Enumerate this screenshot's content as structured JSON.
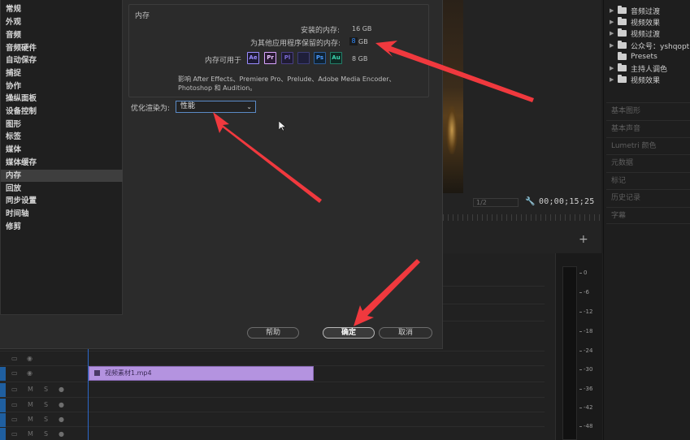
{
  "colors": {
    "accent_red": "#f0393e",
    "clip_purple": "#b493e0",
    "track_blue": "#1f5fa0",
    "playhead": "#2c67c9"
  },
  "sidebar": {
    "items": [
      {
        "label": "常规"
      },
      {
        "label": "外观"
      },
      {
        "label": "音频"
      },
      {
        "label": "音频硬件"
      },
      {
        "label": "自动保存"
      },
      {
        "label": "捕捉"
      },
      {
        "label": "协作"
      },
      {
        "label": "操纵面板"
      },
      {
        "label": "设备控制"
      },
      {
        "label": "图形"
      },
      {
        "label": "标签"
      },
      {
        "label": "媒体"
      },
      {
        "label": "媒体缓存"
      },
      {
        "label": "内存"
      },
      {
        "label": "回放"
      },
      {
        "label": "同步设置"
      },
      {
        "label": "时间轴"
      },
      {
        "label": "修剪"
      }
    ],
    "active_index": 13
  },
  "memory": {
    "section_title": "内存",
    "installed_label": "安装的内存:",
    "installed_value": "16 GB",
    "reserved_label": "为其他应用程序保留的内存:",
    "reserved_value": "8",
    "reserved_unit": "GB",
    "available_label": "内存可用于",
    "available_value": "8 GB",
    "apps": [
      {
        "abbr": "Ae",
        "color": "#9a8cff"
      },
      {
        "abbr": "Pr",
        "color": "#d9a6ff"
      },
      {
        "abbr": "Pl",
        "color": "#7b6bd6"
      },
      {
        "abbr": "",
        "color": "#5d5db8"
      },
      {
        "abbr": "Ps",
        "color": "#4a9bff"
      },
      {
        "abbr": "Au",
        "color": "#3ad6b0"
      }
    ],
    "affects_text": "影响 After Effects、Premiere Pro、Prelude、Adobe Media Encoder、Photoshop 和 Audition。"
  },
  "optimize": {
    "label": "优化渲染为:",
    "selected": "性能",
    "chevron_icon": "chevron-down-icon"
  },
  "buttons": {
    "help": "帮助",
    "ok": "确定",
    "cancel": "取消"
  },
  "monitor": {
    "fraction": "1/2",
    "timecode": "00;00;15;25",
    "wrench_icon": "wrench-icon",
    "add_icon": "plus-icon"
  },
  "project_tree": [
    {
      "label": "音频过渡",
      "expandable": true
    },
    {
      "label": "视频效果",
      "expandable": true
    },
    {
      "label": "视频过渡",
      "expandable": true
    },
    {
      "label": "公众号：yshqopt",
      "expandable": true
    },
    {
      "label": "Presets",
      "expandable": false
    },
    {
      "label": "主持人调色",
      "expandable": true
    },
    {
      "label": "视频效果",
      "expandable": true
    }
  ],
  "panels": [
    "基本图形",
    "基本声音",
    "Lumetri 颜色",
    "元数据",
    "标记",
    "历史记录",
    "字幕"
  ],
  "timeline": {
    "clip_name": "视频素材1.mp4",
    "track_buttons": {
      "mute": "M",
      "solo": "S"
    },
    "meter_scale": [
      "0",
      "-6",
      "-12",
      "-18",
      "-24",
      "-30",
      "-36",
      "-42",
      "-48"
    ]
  }
}
